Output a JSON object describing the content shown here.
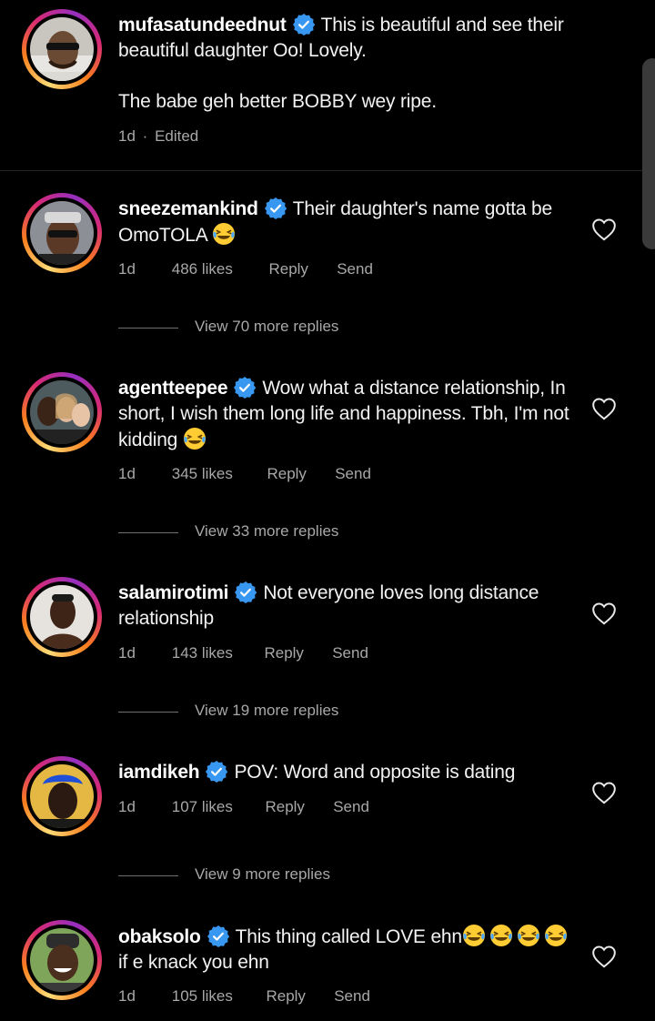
{
  "caption": {
    "username": "mufasatundeednut",
    "text_line1": "This is beautiful and see their",
    "text_line2": "beautiful daughter Oo! Lovely.",
    "text_line3": "The babe geh better BOBBY wey ripe.",
    "time": "1d",
    "separator": "·",
    "edited": "Edited"
  },
  "comments": [
    {
      "username": "sneezemankind",
      "text": "Their daughter's name gotta be OmoTOLA",
      "emoji": "😂",
      "time": "1d",
      "likes": "486 likes",
      "reply": "Reply",
      "send": "Send",
      "view_more": "View 70 more replies"
    },
    {
      "username": "agentteepee",
      "text": "Wow what a distance relationship, In short, I wish them long life and happiness. Tbh, I'm not kidding",
      "emoji": "😂",
      "time": "1d",
      "likes": "345 likes",
      "reply": "Reply",
      "send": "Send",
      "view_more": "View 33 more replies"
    },
    {
      "username": "salamirotimi",
      "text": "Not everyone loves long distance relationship",
      "time": "1d",
      "likes": "143 likes",
      "reply": "Reply",
      "send": "Send",
      "view_more": "View 19 more replies"
    },
    {
      "username": "iamdikeh",
      "text": "POV: Word and opposite is dating",
      "time": "1d",
      "likes": "107 likes",
      "reply": "Reply",
      "send": "Send",
      "view_more": "View 9 more replies"
    },
    {
      "username": "obaksolo",
      "text": "This thing called LOVE ehn",
      "emoji_run": "😂😂😂😂",
      "text_after": "if e knack you ehn",
      "time": "1d",
      "likes": "105 likes",
      "reply": "Reply",
      "send": "Send"
    }
  ],
  "icons": {
    "verified": "verified-badge-icon",
    "like": "heart-outline-icon"
  },
  "colors": {
    "background": "#000000",
    "verified": "#3897f0",
    "meta": "#a8a8a8"
  }
}
